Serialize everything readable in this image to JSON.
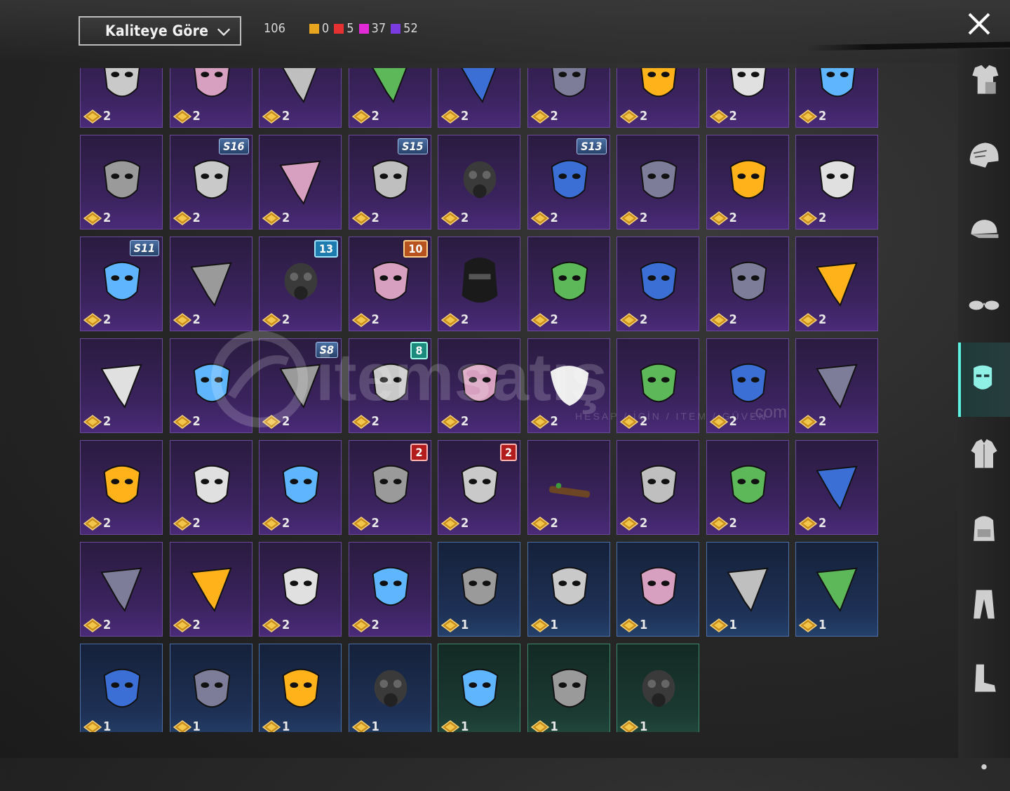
{
  "sort": {
    "label": "Kaliteye Göre"
  },
  "counts": {
    "total": "106",
    "tiers": [
      {
        "color": "#e8a520",
        "value": "0"
      },
      {
        "color": "#e53131",
        "value": "5"
      },
      {
        "color": "#e22ad6",
        "value": "37"
      },
      {
        "color": "#7a3be0",
        "value": "52"
      }
    ]
  },
  "watermark": {
    "brand": "itemsatış",
    "sub": "HESAP  /  İÇİN  /  ITEM  /  GÜVEN",
    "com": ".com"
  },
  "grid": {
    "rows": [
      [
        {
          "q": "2",
          "t": "epic",
          "icon": "sack-mask-icon"
        },
        {
          "q": "2",
          "t": "epic",
          "icon": "pig-mask-icon"
        },
        {
          "q": "2",
          "t": "epic",
          "icon": "skull-bandana-icon"
        },
        {
          "q": "2",
          "t": "epic",
          "icon": "green-bandana-icon"
        },
        {
          "q": "2",
          "t": "epic",
          "icon": "blue-bandana-icon"
        },
        {
          "q": "2",
          "t": "epic",
          "icon": "tactical-mask-icon"
        },
        {
          "q": "2",
          "t": "epic",
          "icon": "pulse-mask-icon"
        },
        {
          "q": "2",
          "t": "epic",
          "icon": "skull-face-icon"
        },
        {
          "q": "2",
          "t": "epic",
          "icon": "cyber-visor-icon"
        }
      ],
      [
        {
          "q": "2",
          "t": "epic",
          "icon": "skull-face-mask-icon"
        },
        {
          "q": "2",
          "t": "epic",
          "icon": "yellow-visor-mask-icon",
          "badge": "S16",
          "bt": "season"
        },
        {
          "q": "2",
          "t": "epic",
          "icon": "dark-bandana-icon"
        },
        {
          "q": "2",
          "t": "epic",
          "icon": "horned-skull-icon",
          "badge": "S15",
          "bt": "season"
        },
        {
          "q": "2",
          "t": "epic",
          "icon": "neon-gas-mask-icon"
        },
        {
          "q": "2",
          "t": "epic",
          "icon": "pilot-helmet-icon",
          "badge": "S13",
          "bt": "season"
        },
        {
          "q": "2",
          "t": "epic",
          "icon": "neck-gaiter-icon"
        },
        {
          "q": "2",
          "t": "epic",
          "icon": "chrome-mask-icon"
        },
        {
          "q": "2",
          "t": "epic",
          "icon": "half-face-mask-icon"
        }
      ],
      [
        {
          "q": "2",
          "t": "epic",
          "icon": "red-half-mask-icon",
          "badge": "S11",
          "bt": "season"
        },
        {
          "q": "2",
          "t": "epic",
          "icon": "black-scarf-icon"
        },
        {
          "q": "2",
          "t": "epic",
          "icon": "respirator-icon",
          "badge": "13",
          "bt": "lvl-blue"
        },
        {
          "q": "2",
          "t": "epic",
          "icon": "teeth-mask-icon",
          "badge": "10",
          "bt": "lvl-orange"
        },
        {
          "q": "2",
          "t": "epic",
          "icon": "balaclava-icon"
        },
        {
          "q": "2",
          "t": "epic",
          "icon": "mummy-wrap-icon"
        },
        {
          "q": "2",
          "t": "epic",
          "icon": "clown-mask-icon"
        },
        {
          "q": "2",
          "t": "epic",
          "icon": "leather-mask-icon"
        },
        {
          "q": "2",
          "t": "epic",
          "icon": "white-bandana-icon"
        }
      ],
      [
        {
          "q": "2",
          "t": "epic",
          "icon": "blue-bandana-icon"
        },
        {
          "q": "2",
          "t": "epic",
          "icon": "black-logo-mask-icon"
        },
        {
          "q": "2",
          "t": "epic",
          "icon": "flame-bandana-icon",
          "badge": "S8",
          "bt": "season"
        },
        {
          "q": "2",
          "t": "epic",
          "icon": "camo-mask-icon",
          "badge": "8",
          "bt": "lvl-teal"
        },
        {
          "q": "2",
          "t": "epic",
          "icon": "orange-mask-icon"
        },
        {
          "q": "2",
          "t": "epic",
          "icon": "white-beard-icon"
        },
        {
          "q": "2",
          "t": "epic",
          "icon": "dark-horror-mask-icon"
        },
        {
          "q": "2",
          "t": "epic",
          "icon": "grin-face-mask-icon"
        },
        {
          "q": "2",
          "t": "epic",
          "icon": "chain-bandana-icon"
        }
      ],
      [
        {
          "q": "2",
          "t": "epic",
          "icon": "graffiti-mask-icon"
        },
        {
          "q": "2",
          "t": "epic",
          "icon": "shark-mask-icon"
        },
        {
          "q": "2",
          "t": "epic",
          "icon": "white-face-mask-icon"
        },
        {
          "q": "2",
          "t": "epic",
          "icon": "grin-skull-mask-icon",
          "badge": "2",
          "bt": "lvl-red"
        },
        {
          "q": "2",
          "t": "epic",
          "icon": "clown-face-icon",
          "badge": "2",
          "bt": "lvl-red"
        },
        {
          "q": "2",
          "t": "epic",
          "icon": "stick-icon"
        },
        {
          "q": "2",
          "t": "epic",
          "icon": "demon-mask-icon"
        },
        {
          "q": "2",
          "t": "epic",
          "icon": "muzzle-mask-icon"
        },
        {
          "q": "2",
          "t": "epic",
          "icon": "black-bandana-icon"
        }
      ],
      [
        {
          "q": "2",
          "t": "epic",
          "icon": "flag-bandana-icon"
        },
        {
          "q": "2",
          "t": "epic",
          "icon": "red-neckerchief-icon"
        },
        {
          "q": "2",
          "t": "epic",
          "icon": "gold-face-mask-icon"
        },
        {
          "q": "2",
          "t": "epic",
          "icon": "hockey-mask-icon"
        },
        {
          "q": "1",
          "t": "rare",
          "icon": "logo-face-mask-icon"
        },
        {
          "q": "1",
          "t": "rare",
          "icon": "golden-face-icon"
        },
        {
          "q": "1",
          "t": "rare",
          "icon": "rusty-mask-icon"
        },
        {
          "q": "1",
          "t": "rare",
          "icon": "net-bandana-icon"
        },
        {
          "q": "1",
          "t": "rare",
          "icon": "web-bandana-icon"
        }
      ],
      [
        {
          "q": "1",
          "t": "rare",
          "icon": "purple-drama-mask-icon"
        },
        {
          "q": "1",
          "t": "rare",
          "icon": "pink-drama-mask-icon"
        },
        {
          "q": "1",
          "t": "rare",
          "icon": "pattern-face-mask-icon"
        },
        {
          "q": "1",
          "t": "rare",
          "icon": "half-respirator-icon"
        },
        {
          "q": "1",
          "t": "uncommon",
          "icon": "smile-face-mask-icon"
        },
        {
          "q": "1",
          "t": "uncommon",
          "icon": "fire-face-mask-icon"
        },
        {
          "q": "1",
          "t": "uncommon",
          "icon": "gas-mask-icon"
        }
      ]
    ]
  },
  "sidebar": [
    {
      "icon": "outfit-icon",
      "active": false
    },
    {
      "icon": "helmet-icon",
      "active": false
    },
    {
      "icon": "cap-icon",
      "active": false
    },
    {
      "icon": "glasses-icon",
      "active": false
    },
    {
      "icon": "mask-icon",
      "active": true
    },
    {
      "icon": "jacket-icon",
      "active": false
    },
    {
      "icon": "backpack-icon",
      "active": false
    },
    {
      "icon": "pants-icon",
      "active": false
    },
    {
      "icon": "boots-icon",
      "active": false
    },
    {
      "icon": "more-icon",
      "active": false
    }
  ]
}
